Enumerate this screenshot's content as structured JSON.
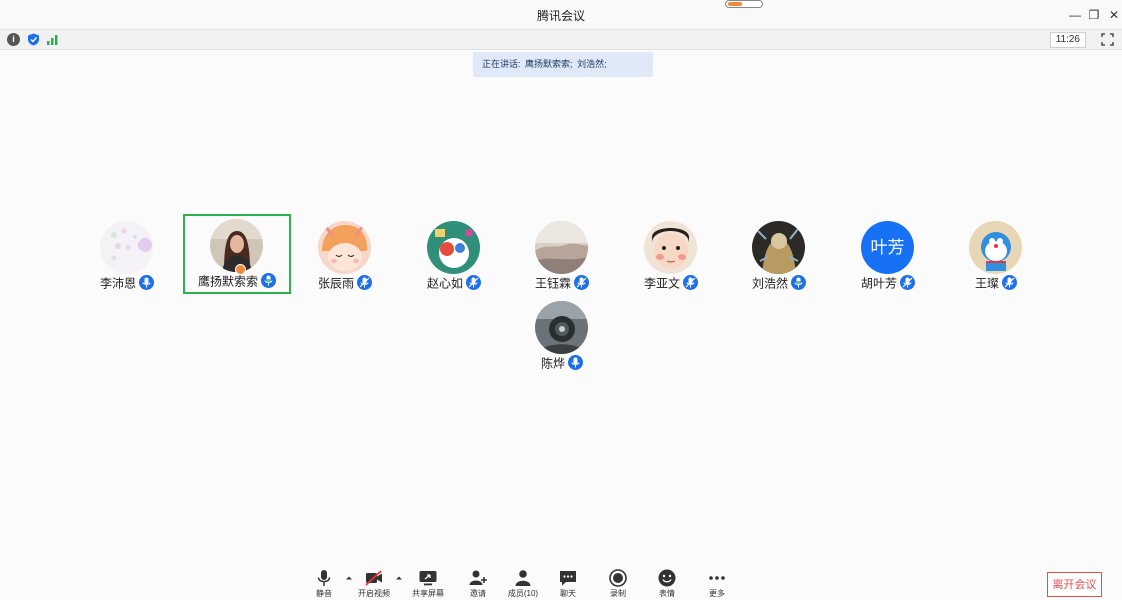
{
  "window": {
    "title": "腾讯会议",
    "minimize_glyph": "—",
    "restore_glyph": "❐",
    "close_glyph": "✕"
  },
  "status_bar": {
    "info_glyph": "i",
    "time": "11:26",
    "icons": [
      "info-icon",
      "shield-icon",
      "signal-icon",
      "fullscreen-icon"
    ]
  },
  "speaking": {
    "prefix": "正在讲话:",
    "speakers": [
      "鹰扬默索索;",
      "刘浩然;"
    ]
  },
  "participants": [
    {
      "name": "李沛恩"
    },
    {
      "name": "鹰扬默索索"
    },
    {
      "name": "张辰雨"
    },
    {
      "name": "赵心如"
    },
    {
      "name": "王钰霖"
    },
    {
      "name": "李亚文"
    },
    {
      "name": "刘浩然"
    },
    {
      "name": "胡叶芳",
      "avatar_text": "叶芳"
    },
    {
      "name": "王璨"
    },
    {
      "name": "陈烨"
    }
  ],
  "toolbar": {
    "mute": "静音",
    "video": "开启视频",
    "share": "共享屏幕",
    "invite": "邀请",
    "members": "成员(10)",
    "chat": "聊天",
    "record": "录制",
    "emoji": "表情",
    "more": "更多",
    "leave": "离开会议"
  },
  "colors": {
    "accent_blue": "#1e6fe8",
    "active_border": "#2ab24c",
    "leave_red": "#e54d4d",
    "banner_bg": "#dfe9f7"
  }
}
